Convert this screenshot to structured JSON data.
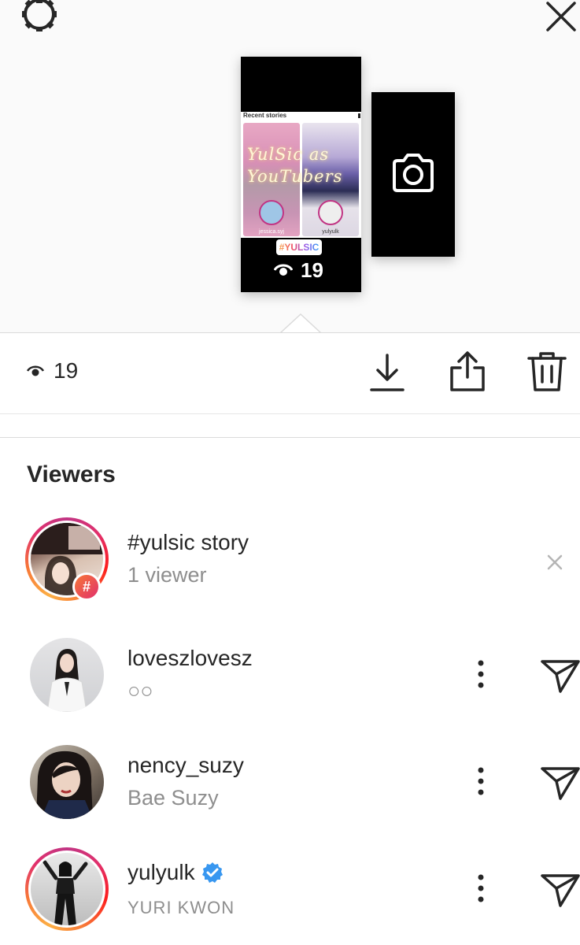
{
  "preview": {
    "story_card": {
      "recent_title": "Recent stories",
      "overlay_text": "YulSic as YouTubers",
      "thumb_a_caption": "jessica.syj",
      "thumb_b_caption": "yulyulk",
      "hashtag_sticker": "#YULSIC",
      "view_count": "19"
    }
  },
  "action_bar": {
    "view_count": "19"
  },
  "viewers": {
    "title": "Viewers",
    "items": [
      {
        "name": "#yulsic story",
        "subtitle": "1 viewer",
        "badge": "#",
        "verified": false
      },
      {
        "name": "loveszlovesz",
        "subtitle": "○○",
        "verified": false
      },
      {
        "name": "nency_suzy",
        "subtitle": "Bae Suzy",
        "verified": false
      },
      {
        "name": "yulyulk",
        "subtitle": "YURI KWON",
        "verified": true
      }
    ]
  },
  "colors": {
    "text_primary": "#262626",
    "text_secondary": "#8e8e8e",
    "verified_blue": "#3897f0",
    "ring_gradient_start": "#c13584",
    "ring_gradient_end": "#fcaf45"
  },
  "icons": [
    "settings-icon",
    "close-icon",
    "camera-icon",
    "eye-icon",
    "download-icon",
    "share-icon",
    "trash-icon",
    "dismiss-icon",
    "more-icon",
    "send-icon",
    "verified-icon"
  ]
}
